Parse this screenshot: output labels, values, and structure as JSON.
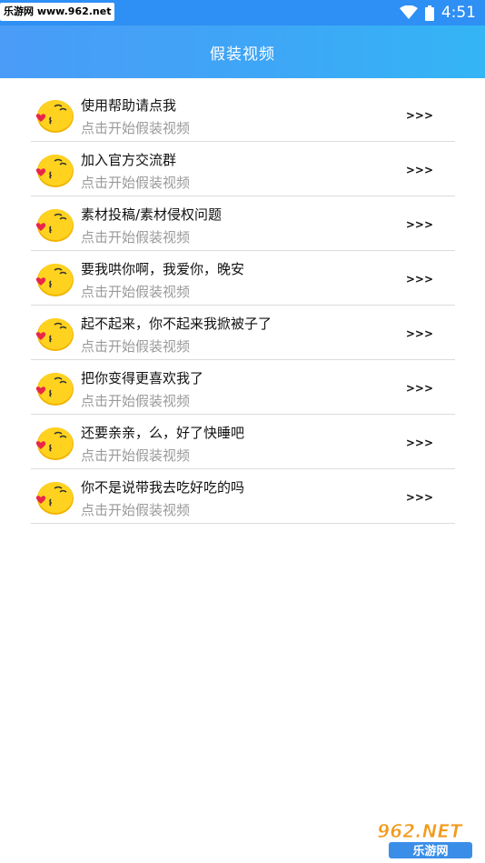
{
  "status_bar": {
    "watermark": "乐游网 www.962.net",
    "time": "4:51",
    "wifi_icon": "wifi-icon",
    "battery_icon": "battery-icon"
  },
  "app_bar": {
    "title": "假装视频"
  },
  "list": {
    "arrow_label": ">>>",
    "avatar_icon": "kiss-emoji-icon",
    "items": [
      {
        "title": "使用帮助请点我",
        "subtitle": "点击开始假装视频"
      },
      {
        "title": "加入官方交流群",
        "subtitle": "点击开始假装视频"
      },
      {
        "title": "素材投稿/素材侵权问题",
        "subtitle": "点击开始假装视频"
      },
      {
        "title": "要我哄你啊，我爱你，晚安",
        "subtitle": "点击开始假装视频"
      },
      {
        "title": "起不起来，你不起来我掀被子了",
        "subtitle": "点击开始假装视频"
      },
      {
        "title": "把你变得更喜欢我了",
        "subtitle": "点击开始假装视频"
      },
      {
        "title": "还要亲亲，么，好了快睡吧",
        "subtitle": "点击开始假装视频"
      },
      {
        "title": "你不是说带我去吃好吃的吗",
        "subtitle": "点击开始假装视频"
      }
    ]
  },
  "watermark_bottom": {
    "text_top": "962.NET",
    "text_bottom": "乐游网"
  },
  "colors": {
    "status_bar": "#2e8ff4",
    "app_bar_start": "#4a9cf7",
    "app_bar_end": "#34b5f5",
    "divider": "#dcdcdc",
    "subtitle": "#9a9a9a"
  }
}
